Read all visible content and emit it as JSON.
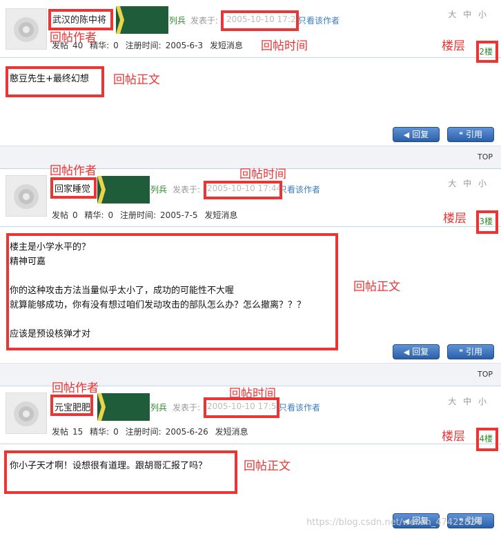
{
  "labels": {
    "posted_prefix": "发表于:",
    "only_author": "只看该作者",
    "font_size": "大 中 小",
    "reply_button": "回复",
    "quote_button": "引用",
    "top_link": "TOP",
    "stat_posts": "发帖",
    "stat_elite": "精华:",
    "stat_reg": "注册时间:",
    "stat_pm": "发短消息"
  },
  "annotations": {
    "author": "回帖作者",
    "time": "回帖时间",
    "floor": "楼层",
    "body": "回帖正文"
  },
  "posts": [
    {
      "author": "武汉的陈中将",
      "rank": "列兵",
      "posted_time": "2005-10-10 17:22",
      "posts_count": "40",
      "elite": "0",
      "reg_date": "2005-6-3",
      "floor": "2楼",
      "content": "憨豆先生+最终幻想"
    },
    {
      "author": "回家睡觉",
      "rank": "列兵",
      "posted_time": "2005-10-10 17:44",
      "posts_count": "0",
      "elite": "0",
      "reg_date": "2005-7-5",
      "floor": "3楼",
      "content": "楼主是小学水平的？\n精神可嘉\n\n你的这种攻击方法当量似乎太小了，成功的可能性不大喔\n就算能够成功，你有没有想过咱们发动攻击的部队怎么办？怎么撤离？？？\n\n应该是预设核弹才对"
    },
    {
      "author": "元宝肥肥",
      "rank": "列兵",
      "posted_time": "2005-10-10 17:56",
      "posts_count": "15",
      "elite": "0",
      "reg_date": "2005-6-26",
      "floor": "4楼",
      "content": "你小子天才啊！设想很有道理。跟胡哥汇报了吗？"
    }
  ],
  "watermark": "https://blog.csdn.net/weixin_47422824"
}
